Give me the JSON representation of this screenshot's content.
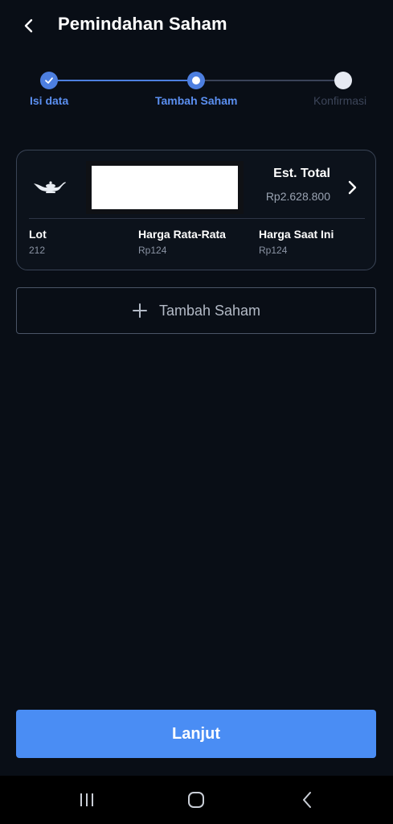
{
  "header": {
    "title": "Pemindahan Saham",
    "back_icon": "chevron-left-icon"
  },
  "stepper": {
    "steps": [
      {
        "label": "Isi data",
        "state": "completed"
      },
      {
        "label": "Tambah Saham",
        "state": "active"
      },
      {
        "label": "Konfirmasi",
        "state": "upcoming"
      }
    ]
  },
  "stock_card": {
    "logo_icon": "genie-lamp-icon",
    "est_total_label": "Est. Total",
    "est_total_value": "Rp2.628.800",
    "lot_label": "Lot",
    "lot_value": "212",
    "avg_price_label": "Harga Rata-Rata",
    "avg_price_value": "Rp124",
    "current_price_label": "Harga Saat Ini",
    "current_price_value": "Rp124"
  },
  "add_stock": {
    "label": "Tambah Saham"
  },
  "primary_action": {
    "label": "Lanjut"
  },
  "colors": {
    "background": "#090e16",
    "accent": "#4a8df4",
    "step_active": "#4d7fe0",
    "card_border": "#3a4456"
  }
}
